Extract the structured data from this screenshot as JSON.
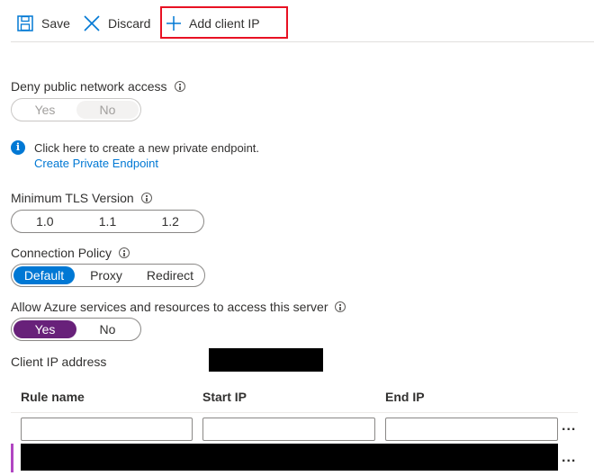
{
  "toolbar": {
    "save_label": "Save",
    "discard_label": "Discard",
    "add_client_ip_label": "Add client IP"
  },
  "deny_public": {
    "label": "Deny public network access",
    "options": [
      "Yes",
      "No"
    ],
    "selected": "No",
    "disabled": true
  },
  "private_endpoint": {
    "message": "Click here to create a new private endpoint.",
    "link_label": "Create Private Endpoint"
  },
  "tls": {
    "label": "Minimum TLS Version",
    "options": [
      "1.0",
      "1.1",
      "1.2"
    ]
  },
  "connection_policy": {
    "label": "Connection Policy",
    "options": [
      "Default",
      "Proxy",
      "Redirect"
    ],
    "selected": "Default"
  },
  "azure_services": {
    "label": "Allow Azure services and resources to access this server",
    "options": [
      "Yes",
      "No"
    ],
    "selected": "Yes"
  },
  "client_ip": {
    "label": "Client IP address",
    "value_redacted": true
  },
  "rules_table": {
    "columns": [
      "Rule name",
      "Start IP",
      "End IP"
    ],
    "new_row": {
      "rule_name": "",
      "start_ip": "",
      "end_ip": ""
    },
    "more_label": "..."
  },
  "colors": {
    "accent_blue": "#0078d4",
    "accent_purple": "#68217a",
    "highlight_red": "#e81123"
  }
}
